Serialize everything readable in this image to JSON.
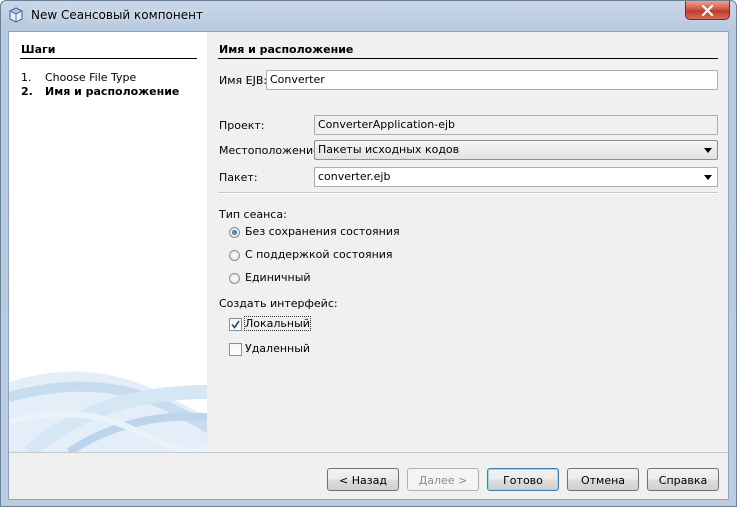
{
  "window": {
    "title": "New Сеансовый компонент"
  },
  "steps": {
    "title": "Шаги",
    "items": [
      {
        "num": "1.",
        "label": "Choose File Type"
      },
      {
        "num": "2.",
        "label": "Имя и расположение"
      }
    ]
  },
  "section": {
    "title": "Имя и расположение"
  },
  "form": {
    "ejb_name_label": "Имя EJB:",
    "ejb_name_value": "Converter",
    "project_label": "Проект:",
    "project_value": "ConverterApplication-ejb",
    "location_label": "Местоположение:",
    "location_value": "Пакеты исходных кодов",
    "package_label": "Пакет:",
    "package_value": "converter.ejb",
    "session_type_label": "Тип сеанса:",
    "session_types": [
      {
        "label": "Без сохранения состояния",
        "checked": true
      },
      {
        "label": "С поддержкой состояния",
        "checked": false
      },
      {
        "label": "Единичный",
        "checked": false
      }
    ],
    "interface_label": "Создать интерфейс:",
    "interfaces": [
      {
        "label": "Локальный",
        "checked": true
      },
      {
        "label": "Удаленный",
        "checked": false
      }
    ]
  },
  "buttons": {
    "back": "< Назад",
    "next": "Далее >",
    "finish": "Готово",
    "cancel": "Отмена",
    "help": "Справка"
  },
  "icons": {
    "app": "netbeans-cube-icon",
    "close": "close-icon"
  },
  "colors": {
    "accent": "#3c7fb1",
    "close": "#c03a2b"
  }
}
